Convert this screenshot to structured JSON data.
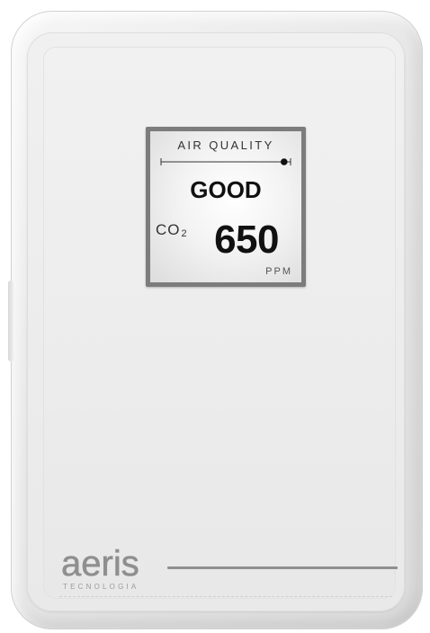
{
  "display": {
    "title": "AIR QUALITY",
    "status": "GOOD",
    "gas_label": "CO",
    "gas_subscript": "2",
    "value": "650",
    "unit": "PPM",
    "scale_indicator_level": 0.95
  },
  "brand": {
    "name": "aeris",
    "tagline": "TECNOLOGIA"
  },
  "colors": {
    "body": "#ececec",
    "bezel": "#7c7c7c",
    "screen": "#f3f3f3",
    "text_dark": "#111111",
    "brand_gray": "#8f8f8f"
  }
}
